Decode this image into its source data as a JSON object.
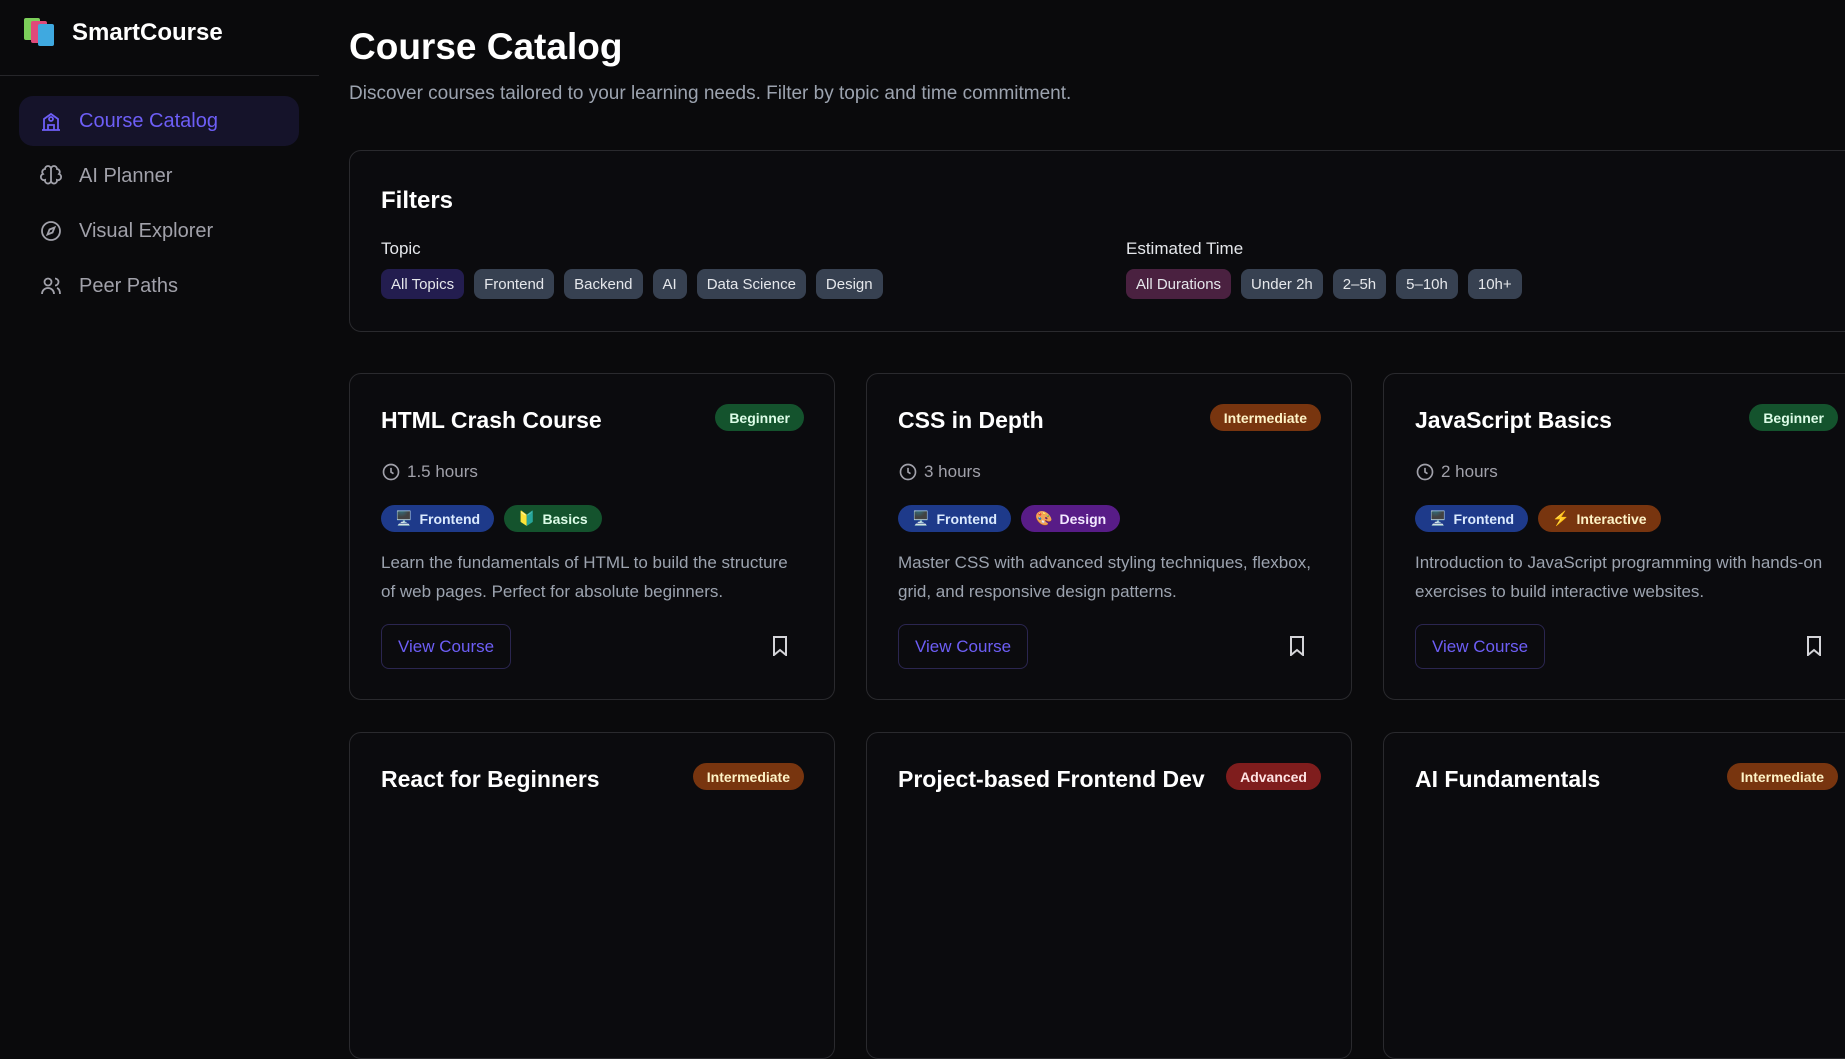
{
  "brand": {
    "name": "SmartCourse",
    "icon": "books-icon"
  },
  "sidebar": {
    "items": [
      {
        "label": "Course Catalog",
        "icon": "school-icon",
        "active": true
      },
      {
        "label": "AI Planner",
        "icon": "brain-icon",
        "active": false
      },
      {
        "label": "Visual Explorer",
        "icon": "compass-icon",
        "active": false
      },
      {
        "label": "Peer Paths",
        "icon": "users-icon",
        "active": false
      }
    ]
  },
  "header": {
    "title": "Course Catalog",
    "subtitle": "Discover courses tailored to your learning needs. Filter by topic and time commitment."
  },
  "filters": {
    "title": "Filters",
    "topic": {
      "label": "Topic",
      "options": [
        "All Topics",
        "Frontend",
        "Backend",
        "AI",
        "Data Science",
        "Design"
      ],
      "selected": "All Topics"
    },
    "time": {
      "label": "Estimated Time",
      "options": [
        "All Durations",
        "Under 2h",
        "2–5h",
        "5–10h",
        "10h+"
      ],
      "selected": "All Durations"
    }
  },
  "colors": {
    "accent": "#6d5ef6",
    "beginner": "#14532d",
    "intermediate": "#78350f",
    "advanced": "#7f1d1d",
    "frontend": "#1e3a8a",
    "design": "#581c87",
    "topic_selected": "#231d4f",
    "time_selected": "#4a2140"
  },
  "courses": [
    {
      "title": "HTML Crash Course",
      "level": "Beginner",
      "hours": "1.5 hours",
      "tags": [
        {
          "emoji": "🖥️",
          "label": "Frontend"
        },
        {
          "emoji": "🔰",
          "label": "Basics"
        }
      ],
      "description": "Learn the fundamentals of HTML to build the structure of web pages. Perfect for absolute beginners.",
      "button": "View Course"
    },
    {
      "title": "CSS in Depth",
      "level": "Intermediate",
      "hours": "3 hours",
      "tags": [
        {
          "emoji": "🖥️",
          "label": "Frontend"
        },
        {
          "emoji": "🎨",
          "label": "Design"
        }
      ],
      "description": "Master CSS with advanced styling techniques, flexbox, grid, and responsive design patterns.",
      "button": "View Course"
    },
    {
      "title": "JavaScript Basics",
      "level": "Beginner",
      "hours": "2 hours",
      "tags": [
        {
          "emoji": "🖥️",
          "label": "Frontend"
        },
        {
          "emoji": "⚡",
          "label": "Interactive"
        }
      ],
      "description": "Introduction to JavaScript programming with hands-on exercises to build interactive websites.",
      "button": "View Course"
    },
    {
      "title": "React for Beginners",
      "level": "Intermediate"
    },
    {
      "title": "Project-based Frontend Dev",
      "level": "Advanced"
    },
    {
      "title": "AI Fundamentals",
      "level": "Intermediate"
    }
  ]
}
